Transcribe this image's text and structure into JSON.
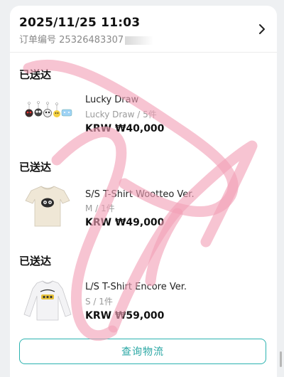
{
  "order": {
    "datetime": "2025/11/25 11:03",
    "number_label": "订单编号",
    "number_value": "25326483307"
  },
  "items": [
    {
      "status": "已送达",
      "name": "Lucky Draw",
      "variant": "Lucky Draw / 5件",
      "price": "KRW ₩40,000",
      "thumb": "keychain-icons"
    },
    {
      "status": "已送达",
      "name": "S/S T-Shirt Wootteo Ver.",
      "variant": "M / 1件",
      "price": "KRW ₩49,000",
      "thumb": "cream-tshirt"
    },
    {
      "status": "已送达",
      "name": "L/S T-Shirt Encore Ver.",
      "variant": "S / 1件",
      "price": "KRW ₩59,000",
      "thumb": "white-longsleeve"
    }
  ],
  "actions": {
    "track_label": "查询物流"
  },
  "colors": {
    "accent": "#2bb3b0",
    "watermark": "#f2a0b6"
  }
}
